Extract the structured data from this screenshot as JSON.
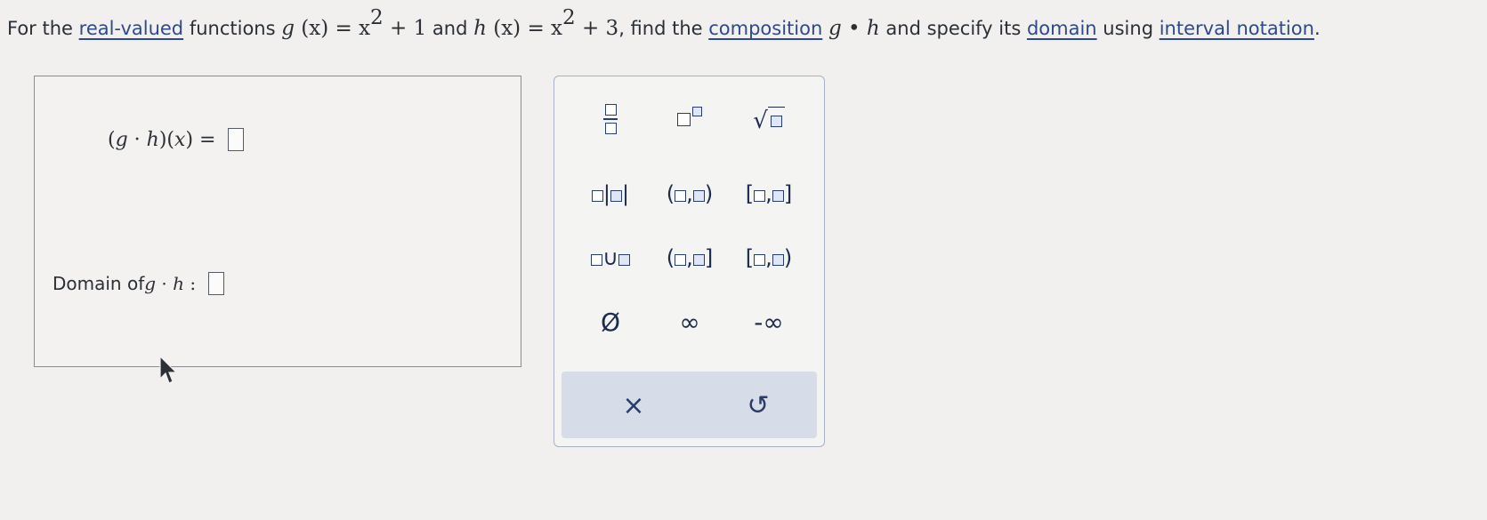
{
  "question": {
    "p1": "For the ",
    "link_real_valued": "real-valued",
    "p2": " functions ",
    "g_def": "g",
    "g_args": " (x) = x",
    "g_exp": "2",
    "g_tail": " + 1",
    "p3": " and ",
    "h_def": "h",
    "h_args": " (x) = x",
    "h_exp": "2",
    "h_tail": " + 3",
    "p4": ", find the ",
    "link_composition": "composition",
    "comp_g": "g",
    "comp_dot": " • ",
    "comp_h": "h",
    "p5": " and specify its ",
    "link_domain": "domain",
    "p6": " using ",
    "link_interval": "interval notation",
    "p7": "."
  },
  "answer": {
    "expr_open": "(",
    "expr_g": "g",
    "expr_dot": " · ",
    "expr_h": "h",
    "expr_mid": ")(",
    "expr_x": "x",
    "expr_close": ") =",
    "domain_label": "Domain of ",
    "domain_g": "g",
    "domain_dot": " · ",
    "domain_h": "h",
    "domain_colon": " :"
  },
  "palette": {
    "open_interval_parens": [
      "(",
      ",",
      ")"
    ],
    "closed_interval": [
      "[",
      ",",
      "]"
    ],
    "half_open_left": [
      "(",
      ",",
      "]"
    ],
    "half_open_right": [
      "[",
      ",",
      ")"
    ],
    "union_symbol": "∪",
    "empty_set": "Ø",
    "infinity": "∞",
    "neg_infinity": "-∞",
    "clear_symbol": "×",
    "undo_symbol": "↺",
    "separator": "|"
  }
}
